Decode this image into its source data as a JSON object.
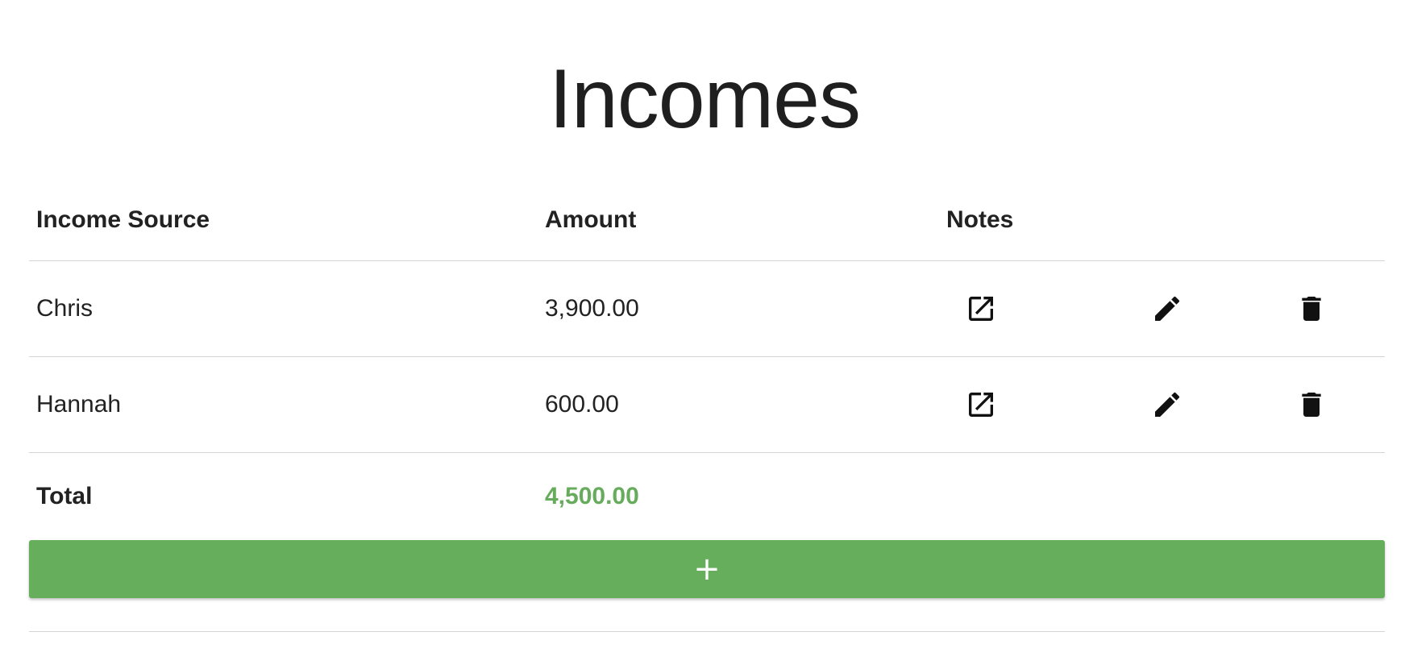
{
  "page": {
    "title": "Incomes"
  },
  "table": {
    "columns": {
      "source": "Income Source",
      "amount": "Amount",
      "notes": "Notes"
    },
    "rows": [
      {
        "source": "Chris",
        "amount": "3,900.00"
      },
      {
        "source": "Hannah",
        "amount": "600.00"
      }
    ],
    "total": {
      "label": "Total",
      "amount": "4,500.00"
    }
  },
  "actions": {
    "add_label": "+"
  },
  "icons": {
    "notes": "open-in-new-icon",
    "edit": "pencil-icon",
    "delete": "trash-icon"
  },
  "colors": {
    "accent": "#67ae5c",
    "total_text": "#66ac5c",
    "divider": "#d4d4d4"
  }
}
